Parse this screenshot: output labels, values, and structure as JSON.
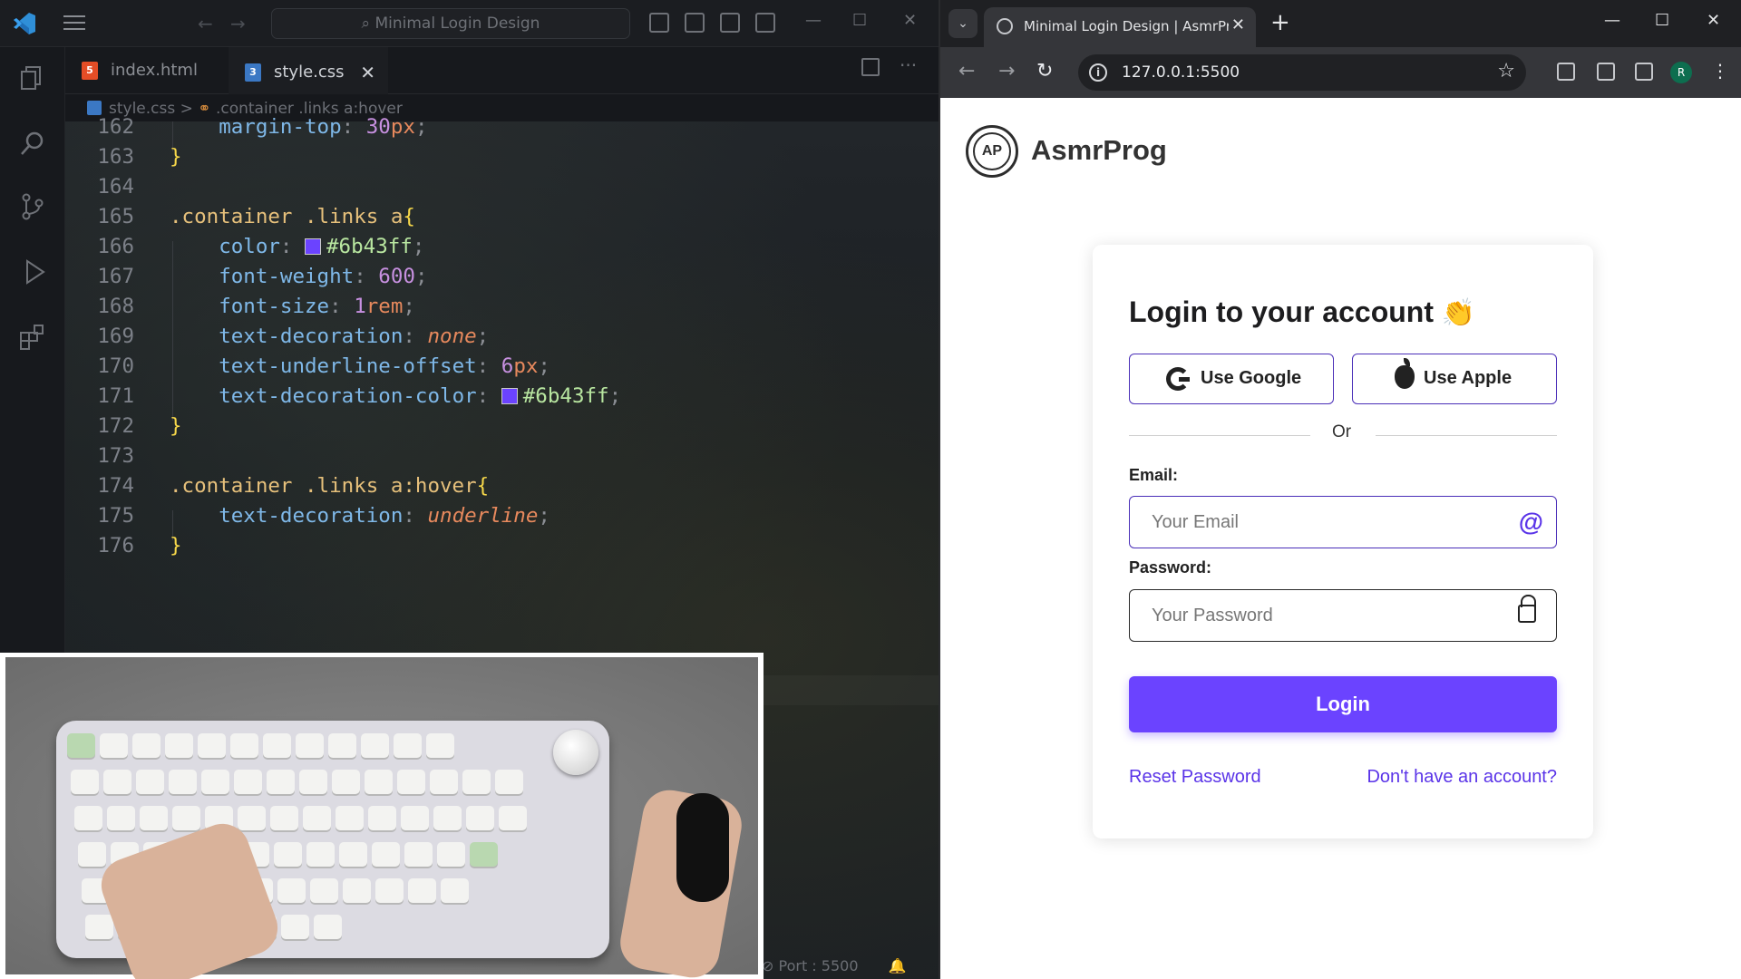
{
  "vscode": {
    "search_text": "Minimal Login Design",
    "tabs": [
      {
        "label": "index.html",
        "icon": "html5-icon"
      },
      {
        "label": "style.css",
        "icon": "css3-icon"
      }
    ],
    "breadcrumb": {
      "file": "style.css",
      "sep": ">",
      "symbol": ".container .links a:hover"
    },
    "status_port": "Port : 5500",
    "code": [
      {
        "n": "162",
        "html": "    <span class='c-prop'>margin-top</span><span class='c-punc'>: </span><span class='c-num'>30</span><span class='c-unit'>px</span><span class='c-punc'>;</span>"
      },
      {
        "n": "163",
        "html": "<span class='c-brace'>}</span>"
      },
      {
        "n": "164",
        "html": ""
      },
      {
        "n": "165",
        "html": "<span class='c-sel'>.container .links a</span><span class='c-brace'>{</span>"
      },
      {
        "n": "166",
        "html": "    <span class='c-prop'>color</span><span class='c-punc'>: </span><span class='swatch'></span><span class='c-hex'>#6b43ff</span><span class='c-punc'>;</span>"
      },
      {
        "n": "167",
        "html": "    <span class='c-prop'>font-weight</span><span class='c-punc'>: </span><span class='c-num'>600</span><span class='c-punc'>;</span>"
      },
      {
        "n": "168",
        "html": "    <span class='c-prop'>font-size</span><span class='c-punc'>: </span><span class='c-num'>1</span><span class='c-unit'>rem</span><span class='c-punc'>;</span>"
      },
      {
        "n": "169",
        "html": "    <span class='c-prop'>text-decoration</span><span class='c-punc'>: </span><span class='c-kw'>none</span><span class='c-punc'>;</span>"
      },
      {
        "n": "170",
        "html": "    <span class='c-prop'>text-underline-offset</span><span class='c-punc'>: </span><span class='c-num'>6</span><span class='c-unit'>px</span><span class='c-punc'>;</span>"
      },
      {
        "n": "171",
        "html": "    <span class='c-prop'>text-decoration-color</span><span class='c-punc'>: </span><span class='swatch'></span><span class='c-hex'>#6b43ff</span><span class='c-punc'>;</span>"
      },
      {
        "n": "172",
        "html": "<span class='c-brace'>}</span>"
      },
      {
        "n": "173",
        "html": ""
      },
      {
        "n": "174",
        "html": "<span class='c-sel'>.container .links a:hover</span><span class='c-brace'>{</span>"
      },
      {
        "n": "175",
        "html": "    <span class='c-prop'>text-decoration</span><span class='c-punc'>: </span><span class='c-kw'>underline</span><span class='c-punc'>;</span>"
      },
      {
        "n": "176",
        "html": "<span class='c-brace'>}</span>"
      }
    ]
  },
  "browser": {
    "tab_title": "Minimal Login Design | AsmrProg",
    "url": "127.0.0.1:5500",
    "profile_initial": "R",
    "brand": {
      "logo_text": "AP",
      "name": "AsmrProg"
    },
    "card": {
      "title": "Login to your account",
      "title_emoji": "👏",
      "google_label": "Use Google",
      "apple_label": "Use Apple",
      "or_text": "Or",
      "email_label": "Email:",
      "email_placeholder": "Your Email",
      "password_label": "Password:",
      "password_placeholder": "Your Password",
      "login_label": "Login",
      "reset_link": "Reset Password",
      "signup_link": "Don't have an account?"
    },
    "accent_color": "#6b43ff"
  }
}
